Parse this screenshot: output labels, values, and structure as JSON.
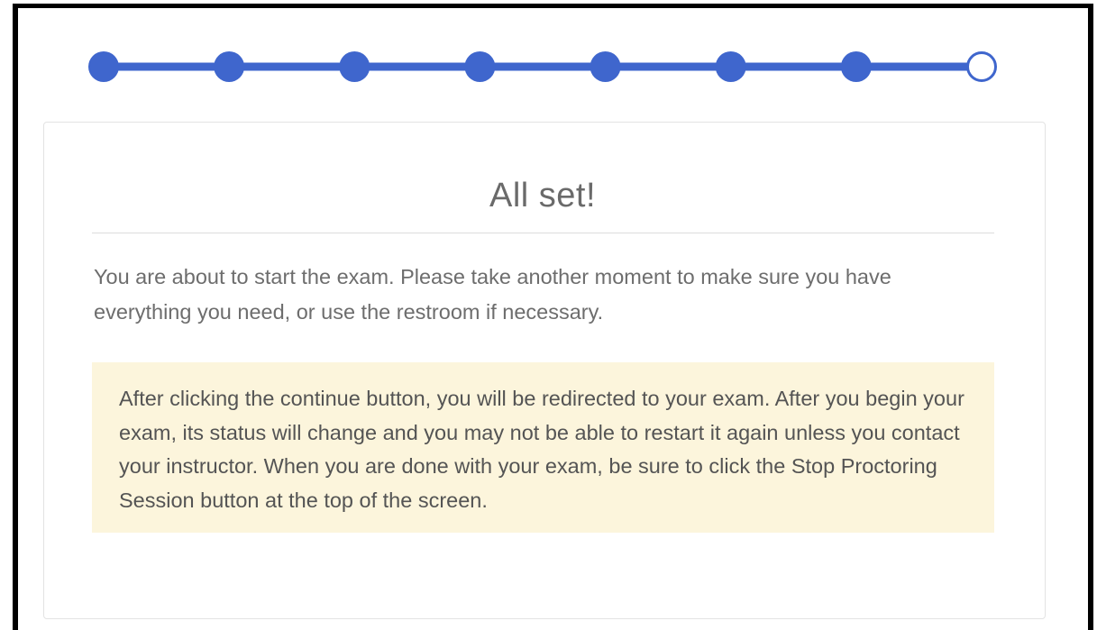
{
  "progress": {
    "steps_total": 8,
    "steps_completed": 7,
    "accent_color": "#3f66cd"
  },
  "card": {
    "title": "All set!",
    "intro": "You are about to start the exam. Please take another moment to make sure you have everything you need, or use the restroom if necessary.",
    "notice": "After clicking the continue button, you will be redirected to your exam. After you begin your exam, its status will change and you may not be able to restart it again unless you contact your instructor. When you are done with your exam, be sure to click the Stop Proctoring Session button at the top of the screen.",
    "notice_bg": "#fcf5dc"
  }
}
